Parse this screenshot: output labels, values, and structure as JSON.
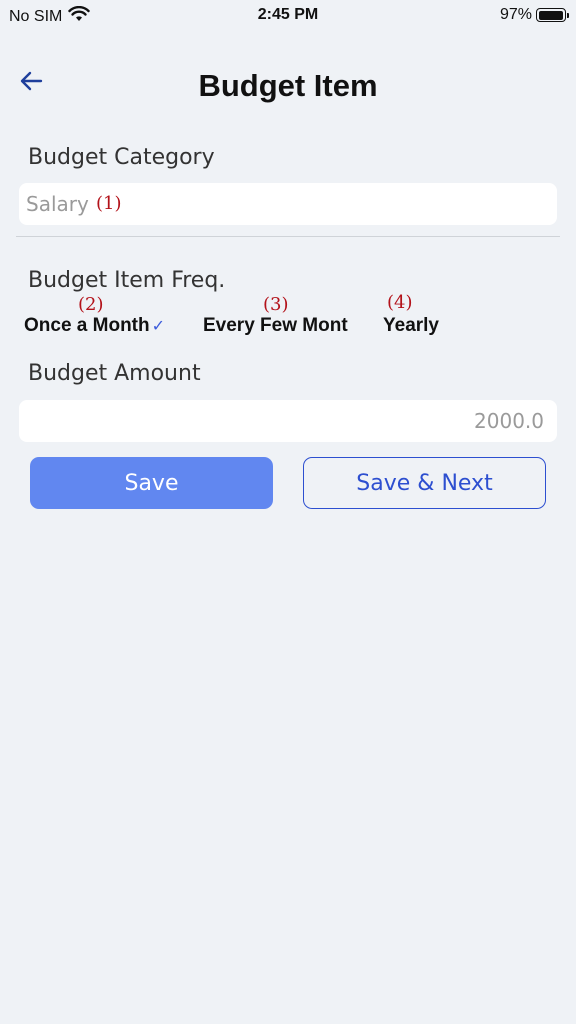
{
  "status_bar": {
    "carrier": "No SIM",
    "time": "2:45 PM",
    "battery_percent": "97%",
    "battery_level": 0.97
  },
  "nav": {
    "back_icon": "arrow-left-icon",
    "title": "Budget Item"
  },
  "category": {
    "label": "Budget Category",
    "value": "Salary"
  },
  "frequency": {
    "label": "Budget Item Freq.",
    "options": [
      {
        "label": "Once a Month",
        "selected": true
      },
      {
        "label": "Every Few Mont",
        "selected": false
      },
      {
        "label": "Yearly",
        "selected": false
      }
    ],
    "check_mark": "✓"
  },
  "amount": {
    "label": "Budget Amount",
    "value": "2000.0"
  },
  "buttons": {
    "save": "Save",
    "save_next": "Save & Next"
  },
  "annotations": [
    "(1)",
    "(2)",
    "(3)",
    "(4)"
  ],
  "colors": {
    "accent": "#6187f0",
    "link": "#2d4fd0",
    "annotation": "#b3121a",
    "background": "#eff2f6"
  }
}
